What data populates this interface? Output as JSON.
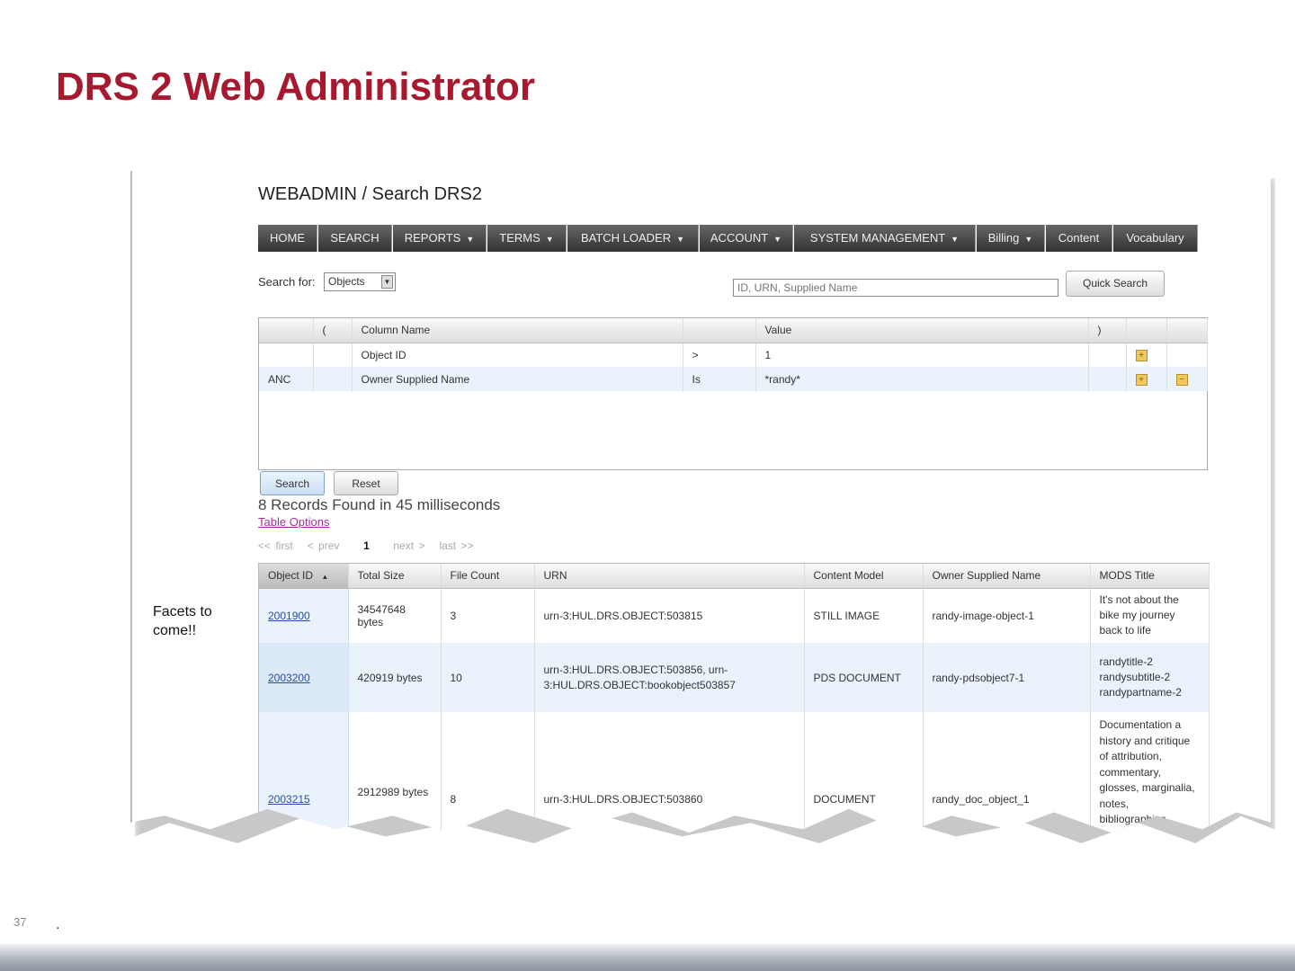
{
  "slide": {
    "title": "DRS 2 Web Administrator",
    "facets_note": "Facets to come!!",
    "page_number": "37",
    "footer_mark": "."
  },
  "app": {
    "title": "WEBADMIN / Search DRS2",
    "nav": [
      {
        "label": "HOME"
      },
      {
        "label": "SEARCH"
      },
      {
        "label": "REPORTS",
        "dropdown": true
      },
      {
        "label": "TERMS",
        "dropdown": true
      },
      {
        "label": "BATCH LOADER",
        "dropdown": true
      },
      {
        "label": "ACCOUNT",
        "dropdown": true
      },
      {
        "label": "SYSTEM MANAGEMENT",
        "dropdown": true
      },
      {
        "label": "Billing",
        "dropdown": true
      },
      {
        "label": "Content"
      },
      {
        "label": "Vocabulary"
      }
    ],
    "search_for_label": "Search for:",
    "search_for_value": "Objects",
    "quick_search_placeholder": "ID, URN, Supplied Name",
    "quick_search_button": "Quick Search",
    "criteria": {
      "headers": [
        "",
        "(",
        "Column Name",
        "",
        "Value",
        ")",
        "",
        ""
      ],
      "rows": [
        {
          "conj": "",
          "paren_open": "",
          "column": "Object ID",
          "op": ">",
          "value": "1",
          "paren_close": ""
        },
        {
          "conj": "ANC",
          "paren_open": "",
          "column": "Owner Supplied Name",
          "op": "Is",
          "value": "*randy*",
          "paren_close": ""
        }
      ]
    },
    "search_button": "Search",
    "reset_button": "Reset",
    "records_found": "8 Records Found in 45 milliseconds",
    "table_options": "Table Options",
    "pager": {
      "first": "<< first",
      "prev": "< prev",
      "current": "1",
      "next": "next >",
      "last": "last >>"
    },
    "results": {
      "headers": [
        "Object ID",
        "Total Size",
        "File Count",
        "URN",
        "Content Model",
        "Owner Supplied Name",
        "MODS Title"
      ],
      "rows": [
        {
          "id": "2001900",
          "size": "34547648 bytes",
          "count": "3",
          "urn": "urn-3:HUL.DRS.OBJECT:503815",
          "model": "STILL IMAGE",
          "owner": "randy-image-object-1",
          "mods": "It's not about the bike my journey back to life"
        },
        {
          "id": "2003200",
          "size": "420919 bytes",
          "count": "10",
          "urn": "urn-3:HUL.DRS.OBJECT:503856, urn-3:HUL.DRS.OBJECT:bookobject503857",
          "model": "PDS DOCUMENT",
          "owner": "randy-pdsobject7-1",
          "mods": "randytitle-2 randysubtitle-2 randypartname-2"
        },
        {
          "id": "2003215",
          "size": "2912989 bytes",
          "count": "8",
          "urn": "urn-3:HUL.DRS.OBJECT:503860",
          "model": "DOCUMENT",
          "owner": "randy_doc_object_1",
          "mods": "Documentation a history and critique of attribution, commentary, glosses, marginalia, notes, bibliographies, works cited"
        }
      ]
    }
  }
}
